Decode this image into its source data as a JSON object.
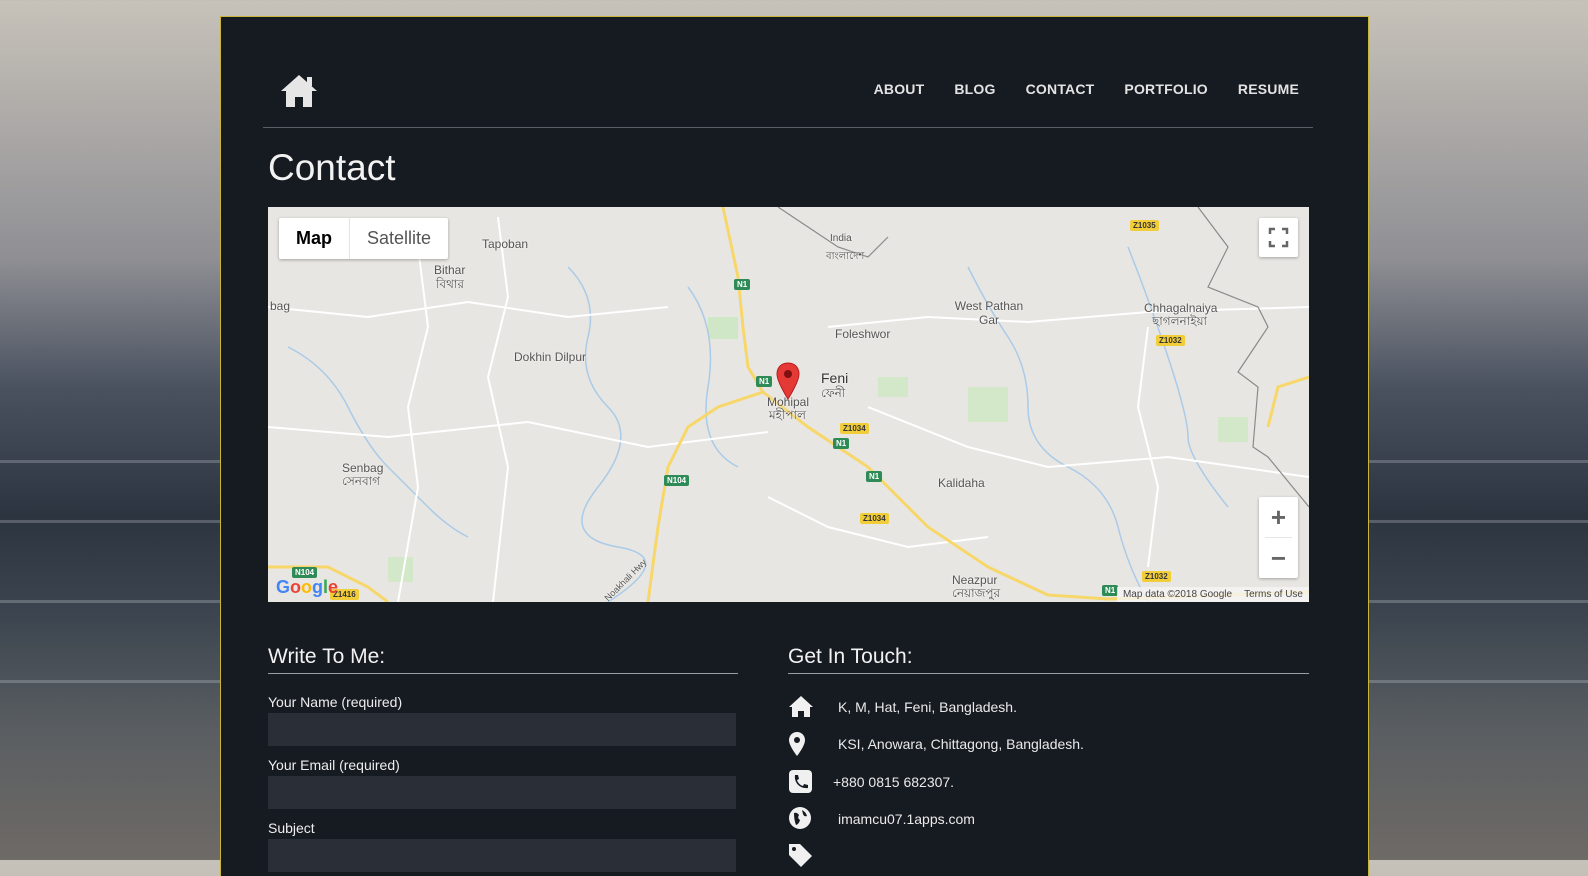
{
  "nav": {
    "home_icon": "home-icon",
    "items": [
      "ABOUT",
      "BLOG",
      "CONTACT",
      "PORTFOLIO",
      "RESUME"
    ]
  },
  "page": {
    "title": "Contact"
  },
  "map": {
    "type_map": "Map",
    "type_satellite": "Satellite",
    "zoom_in": "+",
    "zoom_out": "−",
    "google": "Google",
    "attribution": "Map data ©2018 Google",
    "terms": "Terms of Use",
    "labels": {
      "tapoban": "Tapoban",
      "bithar": "Bithar",
      "bithar_bn": "বিথার",
      "bag": "bag",
      "dokhin_dilpur": "Dokhin Dilpur",
      "india": "India",
      "india_bn": "বাংলাদেশ",
      "foleshwor": "Foleshwor",
      "feni": "Feni",
      "feni_bn": "ফেনী",
      "mohipal": "Mohipal",
      "mohipal_bn": "মহীপাল",
      "west_pathan_gar": "West Pathan Gar",
      "chhagalnaiya": "Chhagalnaiya",
      "chhagalnaiya_bn": "ছাগলনাইয়া",
      "senbag": "Senbag",
      "senbag_bn": "সেনবাগ",
      "kalidaha": "Kalidaha",
      "neazpur": "Neazpur",
      "neazpur_bn": "নেয়াজপুর",
      "noakhali_hwy": "Noakhali Hwy"
    },
    "badges": {
      "n1": "N1",
      "n104": "N104",
      "z1034": "Z1034",
      "z1035": "Z1035",
      "z1032": "Z1032",
      "z1416": "Z1416"
    }
  },
  "write": {
    "title": "Write To Me:",
    "name_label": "Your Name (required)",
    "email_label": "Your Email (required)",
    "subject_label": "Subject"
  },
  "touch": {
    "title": "Get In Touch:",
    "address": "K, M, Hat, Feni, Bangladesh.",
    "location": "KSI, Anowara, Chittagong, Bangladesh.",
    "phone": "+880 0815 682307.",
    "website": "imamcu07.1apps.com"
  },
  "colors": {
    "panel_bg": "#161a21",
    "panel_border": "#c9b53c",
    "input_bg": "#2a2e37",
    "marker": "#e53935"
  }
}
